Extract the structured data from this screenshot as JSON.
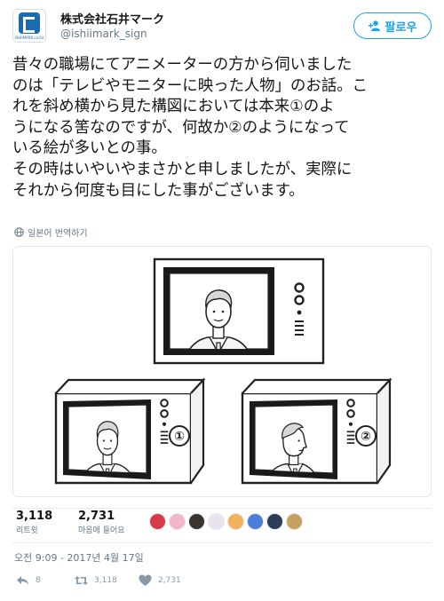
{
  "account": {
    "display_name": "株式会社石井マーク",
    "handle": "@ishiimark_sign",
    "avatar_caption": "ISHIIMARK.co.ltd"
  },
  "follow_button": {
    "label": "팔로우",
    "icon": "add-user-icon"
  },
  "tweet": {
    "lines": [
      "昔々の職場にてアニメーターの方から伺いました",
      "のは「テレビやモニターに映った人物」のお話。こ",
      "れを斜め横から見た構図においては本来①のよ",
      "うになる筈なのですが、何故か②のようになって",
      "いる絵が多いとの事。",
      "その時はいやいやまさかと申しましたが、実際に",
      "それから何度も目にした事がございます。"
    ]
  },
  "translate": {
    "label": "일본어 번역하기",
    "icon": "globe-icon"
  },
  "image": {
    "label_1": "①",
    "label_2": "②"
  },
  "stats": {
    "retweets": "3,118",
    "retweets_label": "리트윗",
    "likes": "2,731",
    "likes_label": "마음에 들어요",
    "liker_colors": [
      "#d93a4a",
      "#f3b7c9",
      "#3a3330",
      "#e9e2ef",
      "#f2b15a",
      "#4a7ed8",
      "#2d3c5a",
      "#c8a15e"
    ]
  },
  "timestamp": "오전 9:09 - 2017년 4월 17일",
  "actions": {
    "reply_count": "8",
    "retweet_count": "3,118",
    "like_count": "2,731"
  },
  "colors": {
    "accent": "#1da1f2",
    "muted": "#657786",
    "border": "#e1e8ed"
  }
}
